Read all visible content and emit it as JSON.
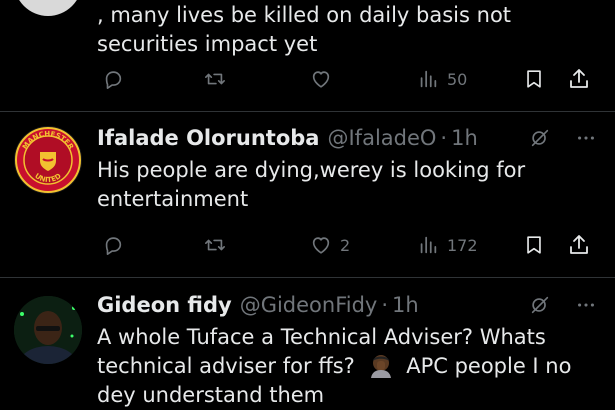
{
  "tweets": [
    {
      "text": ", many lives be killed on daily basis not securities impact yet",
      "actions": {
        "replies": "",
        "reposts": "",
        "likes": "",
        "views": "50"
      }
    },
    {
      "name": "Ifalade Oloruntoba",
      "handle": "@IfaladeO",
      "separator": "·",
      "time": "1h",
      "avatar": {
        "crest_top": "MANCHESTER",
        "crest_bottom": "UNITED"
      },
      "text": "His people are dying,werey is looking for entertainment",
      "actions": {
        "replies": "",
        "reposts": "",
        "likes": "2",
        "views": "172"
      }
    },
    {
      "name": "Gideon fidy",
      "handle": "@GideonFidy",
      "separator": "·",
      "time": "1h",
      "text_before_emoji": "A whole Tuface a Technical Adviser? Whats technical adviser for ffs?",
      "emoji": "person-facepalming",
      "text_after_emoji": "APC people I no dey understand them"
    }
  ],
  "colors": {
    "background": "#000000",
    "text": "#e7e9ea",
    "muted": "#71767b",
    "divider": "#2f3336",
    "crest_red": "#c8102e",
    "crest_gold": "#f2c230"
  },
  "icons": [
    "reply-icon",
    "repost-icon",
    "like-icon",
    "views-icon",
    "bookmark-icon",
    "share-icon",
    "grok-icon",
    "more-icon"
  ]
}
